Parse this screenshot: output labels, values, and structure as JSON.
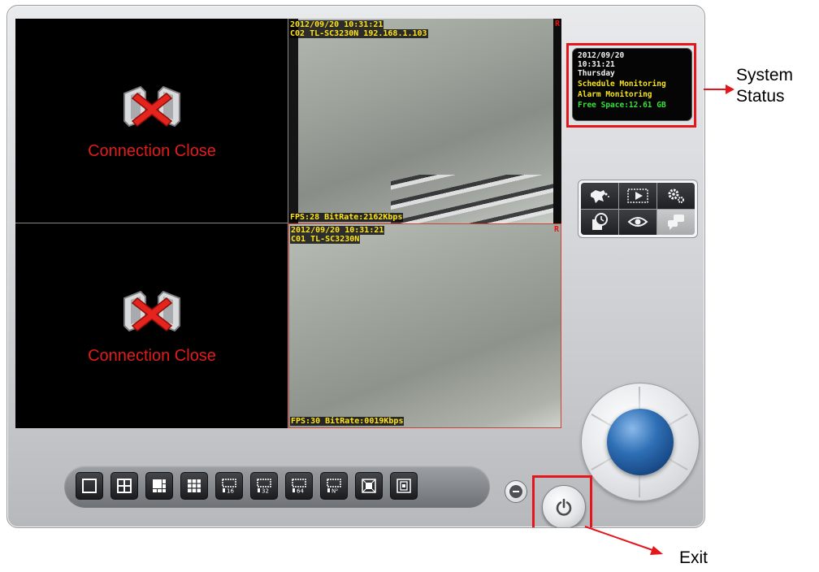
{
  "cameras": [
    {
      "state": "closed",
      "message": "Connection Close"
    },
    {
      "state": "live",
      "timestamp": "2012/09/20 10:31:21",
      "label": "C02 TL-SC3230N 192.168.1.103",
      "stats": "FPS:28 BitRate:2162Kbps",
      "rec_flag": "R"
    },
    {
      "state": "closed",
      "message": "Connection Close"
    },
    {
      "state": "live",
      "timestamp": "2012/09/20 10:31:21",
      "label": "C01 TL-SC3230N",
      "stats": "FPS:30 BitRate:0019Kbps",
      "rec_flag": "R"
    }
  ],
  "status": {
    "date": "2012/09/20",
    "time": "10:31:21",
    "weekday": "Thursday",
    "schedule": "Schedule Monitoring",
    "alarm": "Alarm Monitoring",
    "free_space": "Free Space:12.61 GB"
  },
  "tools": [
    {
      "icon": "emap-icon",
      "enabled": true
    },
    {
      "icon": "playback-icon",
      "enabled": true
    },
    {
      "icon": "settings-icon",
      "enabled": true
    },
    {
      "icon": "schedule-icon",
      "enabled": true
    },
    {
      "icon": "monitor-eye-icon",
      "enabled": true
    },
    {
      "icon": "chat-icon",
      "enabled": false
    }
  ],
  "layouts": [
    {
      "name": "layout-1",
      "badge": ""
    },
    {
      "name": "layout-4",
      "badge": ""
    },
    {
      "name": "layout-6",
      "badge": ""
    },
    {
      "name": "layout-9",
      "badge": ""
    },
    {
      "name": "layout-16",
      "badge": "16"
    },
    {
      "name": "layout-32",
      "badge": "32"
    },
    {
      "name": "layout-64",
      "badge": "64"
    },
    {
      "name": "layout-n2",
      "badge": "N²"
    },
    {
      "name": "fullscreen",
      "badge": ""
    },
    {
      "name": "sequence",
      "badge": ""
    }
  ],
  "callouts": {
    "system_line1": "System",
    "system_line2": "Status",
    "exit": "Exit"
  },
  "colors": {
    "highlight": "#e4151b",
    "osd_text": "#ffe31a",
    "closed_text": "#e21b1b",
    "free_space": "#36e13a",
    "nav_ball": "#2e6fb5"
  }
}
